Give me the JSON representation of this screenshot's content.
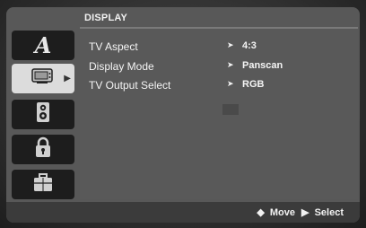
{
  "menu": {
    "title": "DISPLAY",
    "categories": [
      {
        "name": "language",
        "icon": "A"
      },
      {
        "name": "display",
        "icon": "tv"
      },
      {
        "name": "audio",
        "icon": "speaker"
      },
      {
        "name": "lock",
        "icon": "padlock"
      },
      {
        "name": "others",
        "icon": "briefcase"
      }
    ],
    "selected_category": "display",
    "items": [
      {
        "label": "TV Aspect",
        "value": "4:3"
      },
      {
        "label": "Display Mode",
        "value": "Panscan"
      },
      {
        "label": "TV Output Select",
        "value": "RGB"
      }
    ],
    "pointer_glyph": "➤"
  },
  "footer": {
    "move_icon": "◆",
    "move_label": "Move",
    "select_icon": "▶",
    "select_label": "Select"
  },
  "colors": {
    "panel": "#595959",
    "sidebar_item": "#1d1d1d",
    "sidebar_selected": "#dcdcdc",
    "text": "#f4f4f4"
  }
}
